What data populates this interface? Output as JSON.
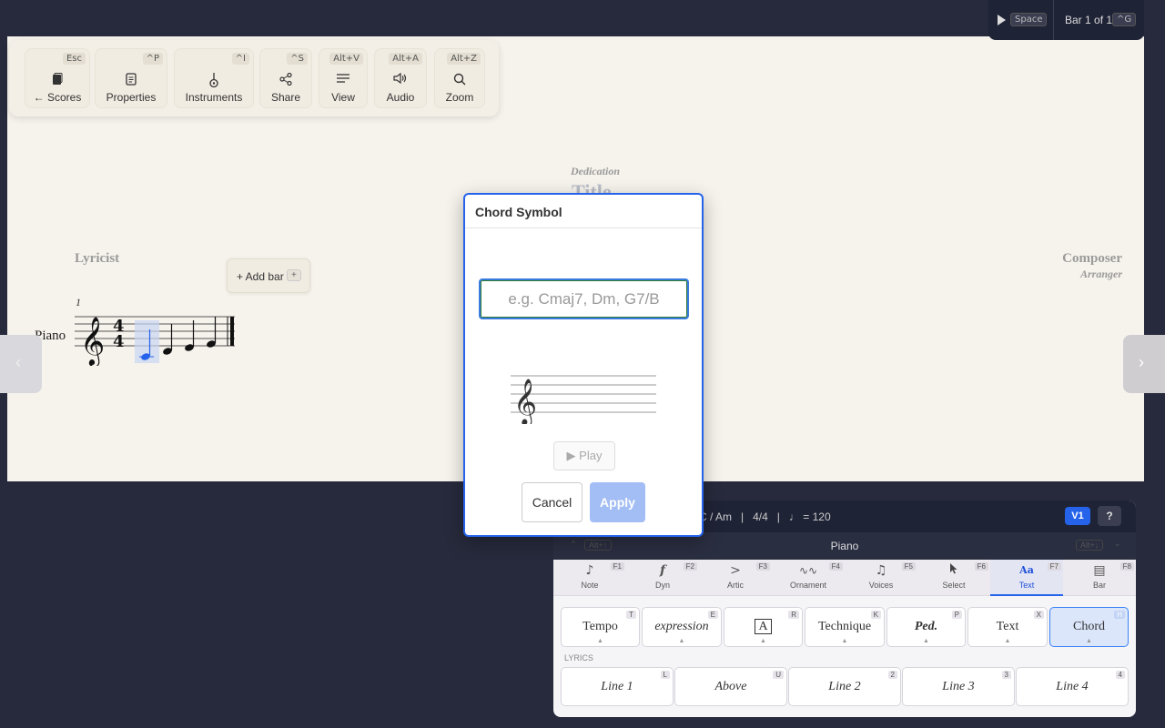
{
  "toolbar": {
    "items": [
      {
        "label": "← Scores",
        "key": "Esc",
        "icon": "book-icon"
      },
      {
        "label": "Properties",
        "key": "^P",
        "icon": "document-icon"
      },
      {
        "label": "Instruments",
        "key": "^I",
        "icon": "guitar-icon"
      },
      {
        "label": "Share",
        "key": "^S",
        "icon": "share-icon"
      },
      {
        "label": "View",
        "key": "Alt+V",
        "icon": "lines-icon"
      },
      {
        "label": "Audio",
        "key": "Alt+A",
        "icon": "speaker-icon"
      },
      {
        "label": "Zoom",
        "key": "Alt+Z",
        "icon": "search-icon"
      }
    ]
  },
  "transport": {
    "play_key": "Space",
    "bar_status": "Bar 1 of 1",
    "goto_key": "^G"
  },
  "score": {
    "dedication": "Dedication",
    "title": "Title",
    "lyricist": "Lyricist",
    "composer": "Composer",
    "arranger": "Arranger",
    "add_bar": "+ Add bar",
    "add_bar_key": "+",
    "bar_number": "1",
    "instrument": "Piano",
    "time_signature": "4/4"
  },
  "dialog": {
    "title": "Chord Symbol",
    "input_placeholder": "e.g. Cmaj7, Dm, G7/B",
    "input_value": "",
    "play": "▶ Play",
    "cancel": "Cancel",
    "apply": "Apply"
  },
  "panel": {
    "status": "C / Am   |   4/4   |   ♩ = 120",
    "voice": "V1",
    "help": "?",
    "instrument": "Piano",
    "prev_key": "Alt+↑",
    "next_key": "Alt+↓",
    "tabs": [
      {
        "label": "Note",
        "key": "F1",
        "icon": "♪"
      },
      {
        "label": "Dyn",
        "key": "F2",
        "icon": "𝆑"
      },
      {
        "label": "Artic",
        "key": "F3",
        "icon": ">"
      },
      {
        "label": "Ornament",
        "key": "F4",
        "icon": "〰"
      },
      {
        "label": "Voices",
        "key": "F5",
        "icon": "♫"
      },
      {
        "label": "Select",
        "key": "F6",
        "icon": "➚"
      },
      {
        "label": "Text",
        "key": "F7",
        "icon": "Aa"
      },
      {
        "label": "Bar",
        "key": "F8",
        "icon": "▤"
      }
    ],
    "active_tab": "Text",
    "palette": [
      {
        "label": "Tempo",
        "key": "T"
      },
      {
        "label": "expression",
        "key": "E"
      },
      {
        "label": "A",
        "key": "R"
      },
      {
        "label": "Technique",
        "key": "K"
      },
      {
        "label": "Ped.",
        "key": "P"
      },
      {
        "label": "Text",
        "key": "X"
      },
      {
        "label": "Chord",
        "key": "H"
      }
    ],
    "lyrics_heading": "LYRICS",
    "lyrics": [
      {
        "label": "Line 1",
        "key": "L"
      },
      {
        "label": "Above",
        "key": "U"
      },
      {
        "label": "Line 2",
        "key": "2"
      },
      {
        "label": "Line 3",
        "key": "3"
      },
      {
        "label": "Line 4",
        "key": "4"
      }
    ]
  },
  "colors": {
    "accent": "#2563eb",
    "background": "#262a3c",
    "paper": "#f6f2ec"
  }
}
